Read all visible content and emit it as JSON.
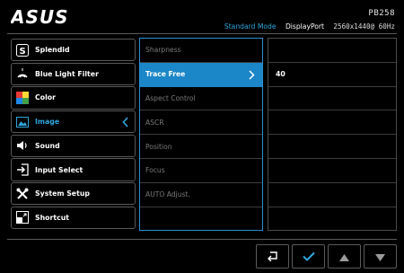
{
  "brand": "ASUS",
  "model": "PB258",
  "status": {
    "mode": "Standard Mode",
    "input": "DisplayPort",
    "resolution": "2560x1440@ 60Hz"
  },
  "menu": [
    {
      "label": "Splendid",
      "icon": "splendid-icon"
    },
    {
      "label": "Blue Light Filter",
      "icon": "blue-light-filter-icon"
    },
    {
      "label": "Color",
      "icon": "color-palette-icon"
    },
    {
      "label": "Image",
      "icon": "image-icon",
      "active": true
    },
    {
      "label": "Sound",
      "icon": "speaker-icon"
    },
    {
      "label": "Input Select",
      "icon": "input-select-icon"
    },
    {
      "label": "System Setup",
      "icon": "tools-icon"
    },
    {
      "label": "Shortcut",
      "icon": "shortcut-icon"
    }
  ],
  "submenu": [
    {
      "label": "Sharpness"
    },
    {
      "label": "Trace Free",
      "selected": true
    },
    {
      "label": "Aspect Control"
    },
    {
      "label": "ASCR"
    },
    {
      "label": "Position"
    },
    {
      "label": "Focus"
    },
    {
      "label": "AUTO Adjust."
    },
    {
      "label": ""
    }
  ],
  "value_panel": [
    "40",
    "",
    "",
    "",
    "",
    "",
    "",
    ""
  ],
  "nav_buttons": [
    "back-icon",
    "check-icon",
    "up-arrow-icon",
    "down-arrow-icon"
  ],
  "colors": {
    "accent": "#1b86c8",
    "highlight_text": "#2fa6dc",
    "dim_text": "#7a7a7a"
  }
}
